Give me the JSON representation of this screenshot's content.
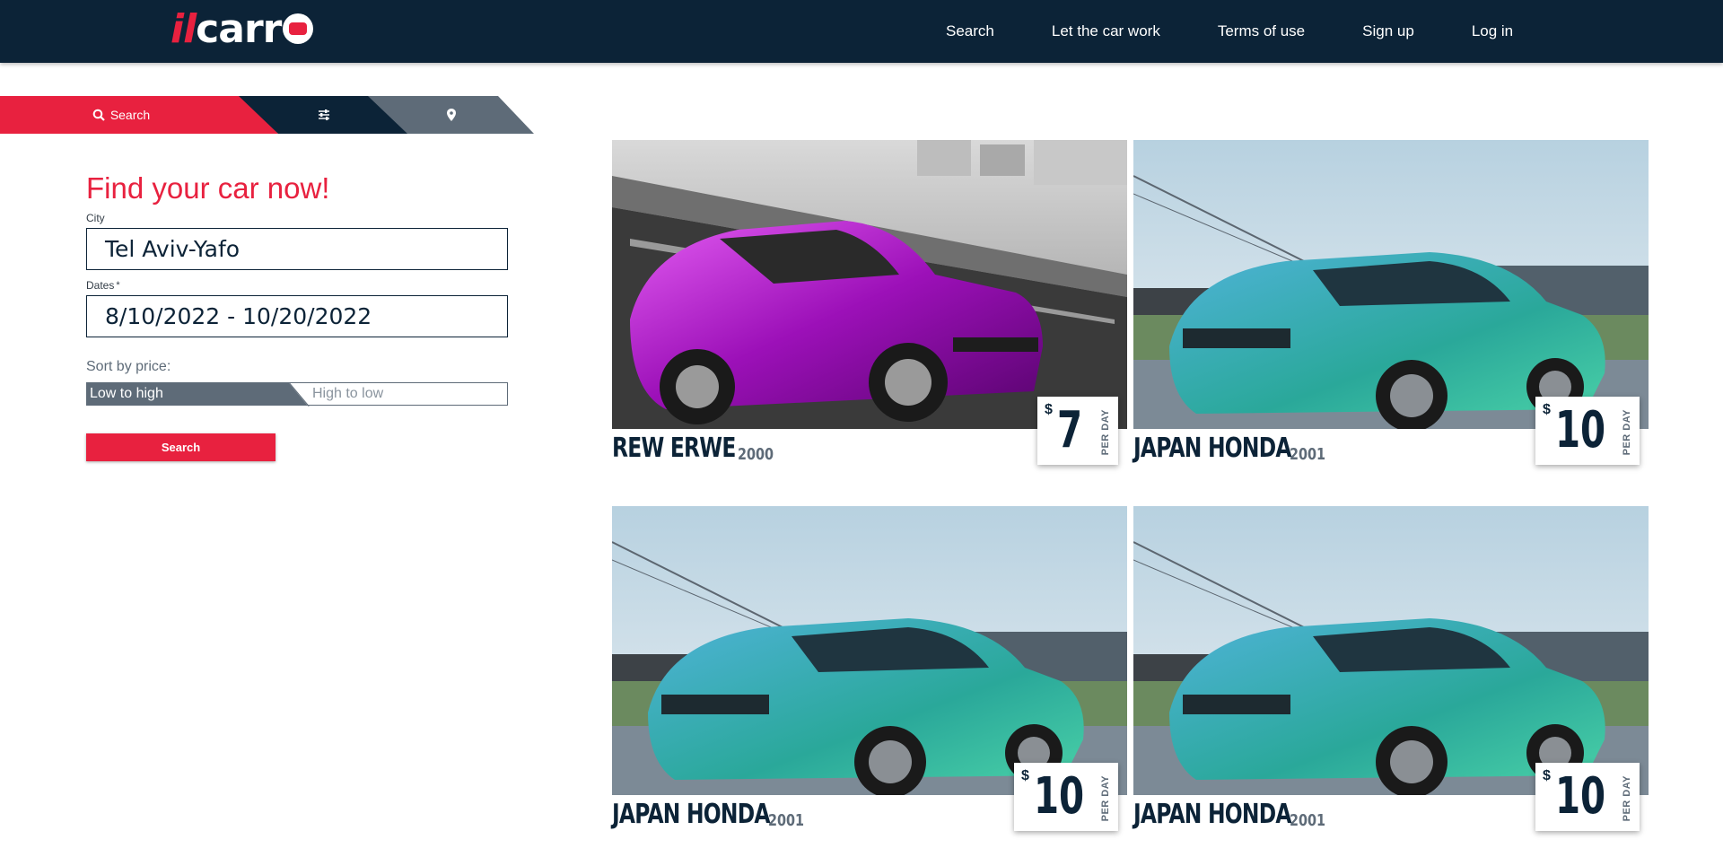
{
  "header": {
    "logo": {
      "il": "il",
      "carr": "carr"
    },
    "nav": [
      {
        "label": "Search"
      },
      {
        "label": "Let the car work"
      },
      {
        "label": "Terms of use"
      },
      {
        "label": "Sign up"
      },
      {
        "label": "Log in"
      }
    ]
  },
  "tabs": {
    "search_label": "Search",
    "icons": [
      "search-icon",
      "sliders-icon",
      "map-marker-icon"
    ]
  },
  "form": {
    "title": "Find your car now!",
    "city_label": "City",
    "city_value": "Tel Aviv-Yafo",
    "dates_label": "Dates",
    "dates_required_mark": "*",
    "dates_value": "8/10/2022 - 10/20/2022",
    "sort_label": "Sort by price:",
    "sort_options": [
      "Low to high",
      "High to low"
    ],
    "sort_selected": "Low to high",
    "search_button": "Search"
  },
  "cars": [
    {
      "name": "REW ERWE",
      "year": "2000",
      "currency": "$",
      "price": "7",
      "per": "PER DAY",
      "color": "#b21fd0"
    },
    {
      "name": "JAPAN HONDA",
      "year": "2001",
      "currency": "$",
      "price": "10",
      "per": "PER DAY",
      "color": "#2fa9bd"
    },
    {
      "name": "JAPAN HONDA",
      "year": "2001",
      "currency": "$",
      "price": "10",
      "per": "PER DAY",
      "color": "#2fa9bd"
    },
    {
      "name": "JAPAN HONDA",
      "year": "2001",
      "currency": "$",
      "price": "10",
      "per": "PER DAY",
      "color": "#2fa9bd"
    }
  ],
  "colors": {
    "brand_red": "#e8213f",
    "navy": "#0c2337",
    "slate": "#5e6b78"
  }
}
